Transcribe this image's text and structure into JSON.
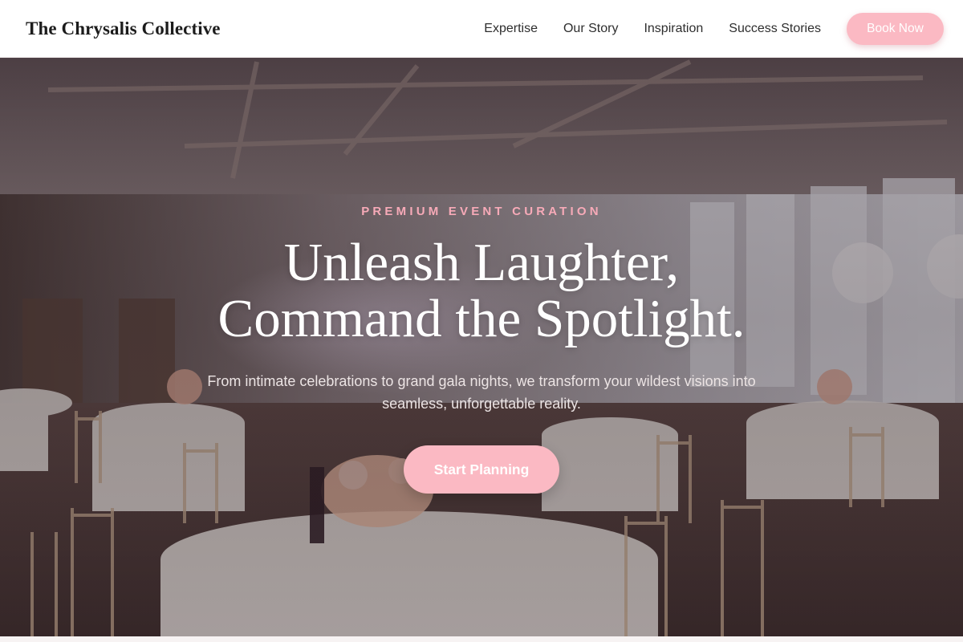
{
  "header": {
    "brand": "The Chrysalis Collective",
    "nav": [
      "Expertise",
      "Our Story",
      "Inspiration",
      "Success Stories"
    ],
    "book_label": "Book Now"
  },
  "hero": {
    "eyebrow": "PREMIUM EVENT CURATION",
    "headline_line1": "Unleash Laughter,",
    "headline_line2": "Command the Spotlight.",
    "subtext": "From intimate celebrations to grand gala nights, we transform your wildest visions into seamless, unforgettable reality.",
    "cta_label": "Start Planning"
  },
  "colors": {
    "accent": "#fbb9c3",
    "eyebrow": "#f7aab8",
    "text_dark": "#1c1c1c"
  }
}
